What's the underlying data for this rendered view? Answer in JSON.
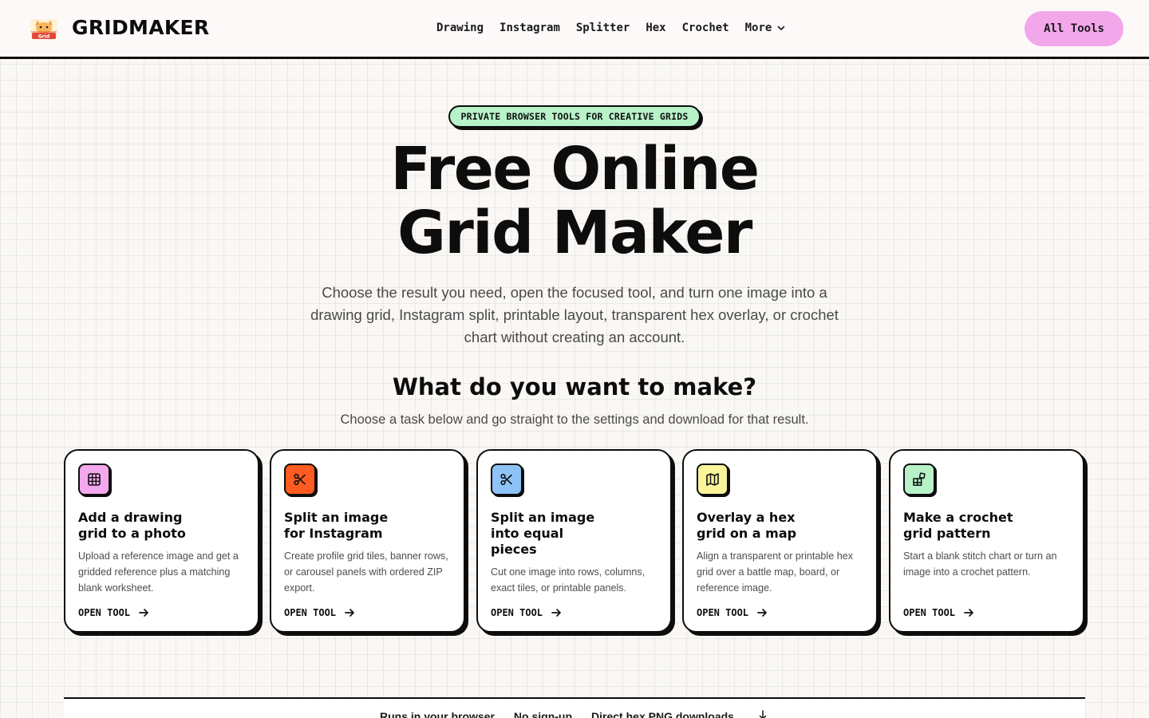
{
  "brand": {
    "name": "GRIDMAKER",
    "logo_icon": "gridmaker-cat-logo"
  },
  "nav": {
    "items": [
      "Drawing",
      "Instagram",
      "Splitter",
      "Hex",
      "Crochet"
    ],
    "more_label": "More"
  },
  "header": {
    "all_tools_label": "All Tools",
    "all_tools_color": "#f3a7eb"
  },
  "hero": {
    "pill": "PRIVATE BROWSER TOOLS FOR CREATIVE GRIDS",
    "pill_color": "#b7f2c9",
    "title_line1": "Free Online",
    "title_line2": "Grid Maker",
    "description": "Choose the result you need, open the focused tool, and turn one image into a drawing grid, Instagram split, printable layout, transparent hex overlay, or crochet chart without creating an account."
  },
  "section": {
    "title": "What do you want to make?",
    "subtitle": "Choose a task below and go straight to the settings and download for that result."
  },
  "cards": [
    {
      "icon": "grid-icon",
      "color": "#f4a8ee",
      "title": "Add a drawing grid to a photo",
      "description": "Upload a reference image and get a gridded reference plus a matching blank worksheet.",
      "link": "OPEN TOOL"
    },
    {
      "icon": "scissors-icon",
      "color": "#ff5a1f",
      "title": "Split an image for Instagram",
      "description": "Create profile grid tiles, banner rows, or carousel panels with ordered ZIP export.",
      "link": "OPEN TOOL"
    },
    {
      "icon": "scissors-icon",
      "color": "#8ec3f7",
      "title": "Split an image into equal pieces",
      "description": "Cut one image into rows, columns, exact tiles, or printable panels.",
      "link": "OPEN TOOL"
    },
    {
      "icon": "map-icon",
      "color": "#fbf59a",
      "title": "Overlay a hex grid on a map",
      "description": "Align a transparent or printable hex grid over a battle map, board, or reference image.",
      "link": "OPEN TOOL"
    },
    {
      "icon": "blocks-icon",
      "color": "#b7f2c9",
      "title": "Make a crochet grid pattern",
      "description": "Start a blank stitch chart or turn an image into a crochet pattern.",
      "link": "OPEN TOOL"
    }
  ],
  "bottom_bar": {
    "items": [
      "Runs in your browser",
      "No sign-up",
      "Direct hex PNG downloads"
    ]
  }
}
